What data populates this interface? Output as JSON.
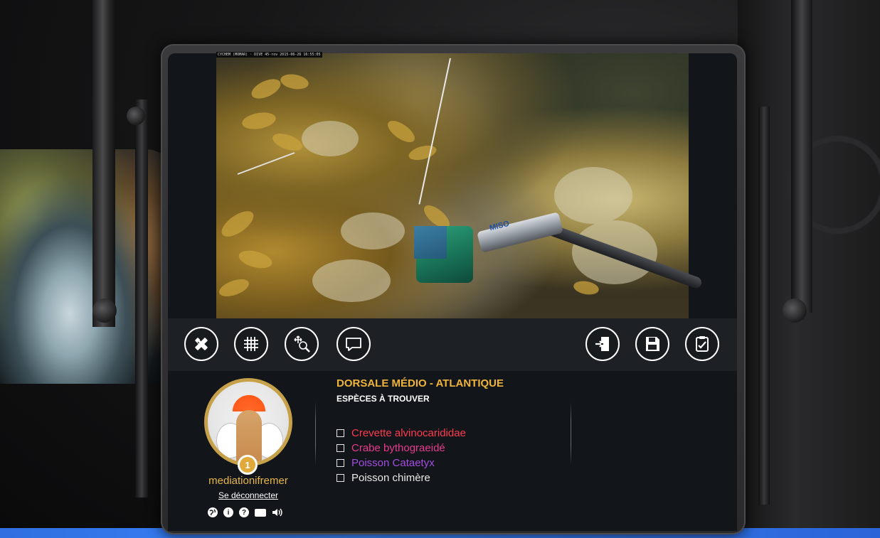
{
  "video": {
    "timestamp": "CYCHEM  (MOMAR) · DIVE 45-rov 2015-06-26 16:55:05",
    "probe_label": "MISO"
  },
  "toolbar": {
    "left_tools": [
      "measure-tool",
      "grid-tool",
      "zoom-tool",
      "comment-tool"
    ],
    "right_tools": [
      "exit-tool",
      "save-tool",
      "checklist-tool"
    ]
  },
  "user": {
    "level": "1",
    "username": "mediationifremer",
    "logout_label": "Se déconnecter"
  },
  "mini_icons": {
    "globe": "globe-icon",
    "info": "i",
    "help": "?",
    "video": "video-icon",
    "sound": "sound-icon"
  },
  "region": {
    "title": "DORSALE MÉDIO - ATLANTIQUE",
    "subtitle": "ESPÈCES À TROUVER"
  },
  "species": [
    {
      "label": "Crevette alvinocarididae",
      "color": "#ff3b4e"
    },
    {
      "label": "Crabe bythograeidé",
      "color": "#e83a8c"
    },
    {
      "label": "Poisson Cataetyx",
      "color": "#a44de0"
    },
    {
      "label": "Poisson chimère",
      "color": "#e8e8e8"
    }
  ]
}
